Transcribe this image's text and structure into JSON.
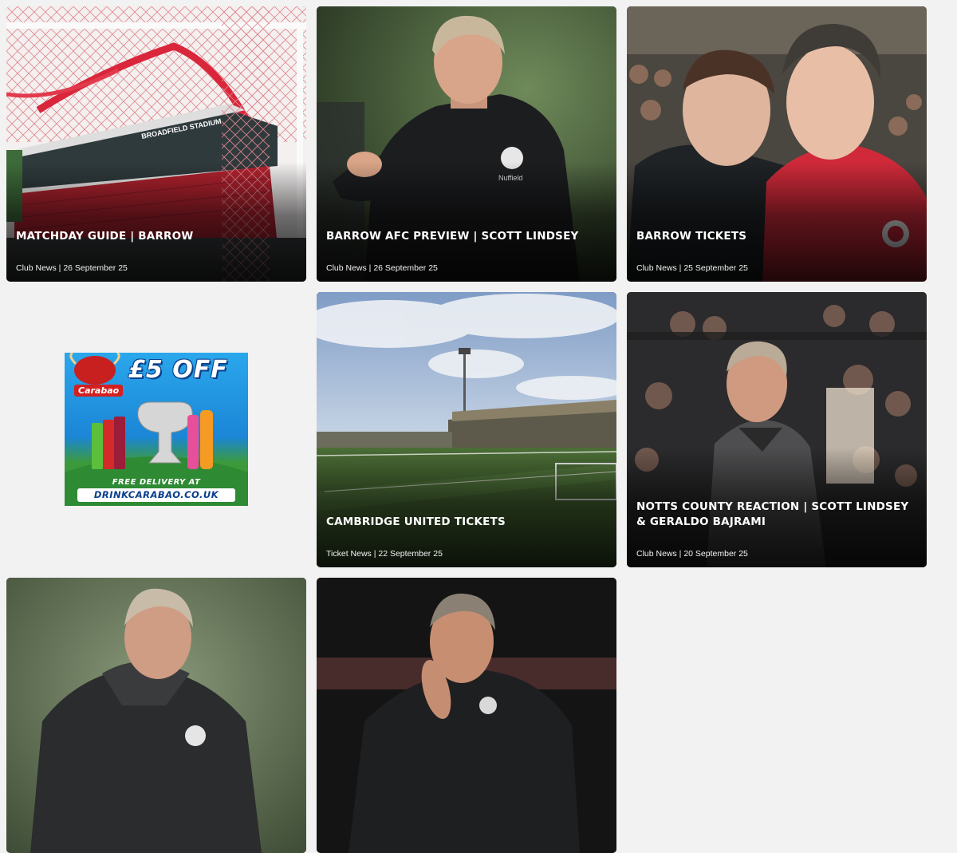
{
  "articles": [
    {
      "title": "MATCHDAY GUIDE | BARROW",
      "category": "Club News",
      "date": "26 September 25",
      "meta": "Club News | 26 September 25"
    },
    {
      "title": "BARROW AFC PREVIEW | SCOTT LINDSEY",
      "category": "Club News",
      "date": "26 September 25",
      "meta": "Club News | 26 September 25"
    },
    {
      "title": "BARROW TICKETS",
      "category": "Club News",
      "date": "25 September 25",
      "meta": "Club News | 25 September 25"
    },
    {
      "title": "CAMBRIDGE UNITED TICKETS",
      "category": "Ticket News",
      "date": "22 September 25",
      "meta": "Ticket News | 22 September 25"
    },
    {
      "title": "NOTTS COUNTY REACTION | SCOTT LINDSEY & GERALDO BAJRAMI",
      "category": "Club News",
      "date": "20 September 25",
      "meta": "Club News | 20 September 25"
    },
    {
      "title": "",
      "meta": ""
    },
    {
      "title": "",
      "meta": ""
    }
  ],
  "advert": {
    "brand": "Carabao",
    "headline": "£5 OFF",
    "delivery": "FREE DELIVERY AT",
    "url": "DRINKCARABAO.CO.UK"
  },
  "image_signage": {
    "stadium_name": "BROADFIELD STADIUM"
  }
}
